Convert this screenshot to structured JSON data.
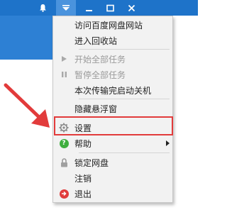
{
  "titlebar": {
    "buttons": [
      {
        "icon": "bell-icon",
        "glyph": "🔔"
      },
      {
        "icon": "dropdown-icon",
        "glyph": "▾"
      },
      {
        "icon": "minimize-icon",
        "glyph": "—"
      },
      {
        "icon": "maximize-icon",
        "glyph": "☐"
      },
      {
        "icon": "close-icon",
        "glyph": "✕"
      }
    ]
  },
  "menu": {
    "items": [
      {
        "label": "访问百度网盘网站",
        "icon": "",
        "disabled": false
      },
      {
        "label": "进入回收站",
        "icon": "",
        "disabled": false
      },
      {
        "label": "开始全部任务",
        "icon": "play-icon",
        "disabled": true
      },
      {
        "label": "暂停全部任务",
        "icon": "pause-icon",
        "disabled": true
      },
      {
        "label": "本次传输完启动关机",
        "icon": "",
        "disabled": false
      },
      {
        "label": "隐藏悬浮窗",
        "icon": "",
        "disabled": false
      },
      {
        "label": "设置",
        "icon": "gear-icon",
        "disabled": false
      },
      {
        "label": "帮助",
        "icon": "help-icon",
        "disabled": false,
        "submenu": true
      },
      {
        "label": "锁定网盘",
        "icon": "lock-icon",
        "disabled": false
      },
      {
        "label": "注销",
        "icon": "",
        "disabled": false
      },
      {
        "label": "退出",
        "icon": "exit-icon",
        "disabled": false
      }
    ]
  },
  "colors": {
    "titlebar": "#1e73c9",
    "highlight": "#e23b3b",
    "help_icon": "#3fae3f",
    "exit_icon": "#e03c3c"
  }
}
